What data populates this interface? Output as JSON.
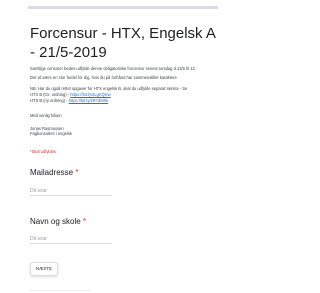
{
  "form": {
    "title": "Forcensur - HTX, Engelsk A - 21/5-2019",
    "description": [
      "Samtlige censorer bedes udfylde denne obligatoriske forcensur senest torsdag d.13/6 kl 12.",
      "Det vil være en stor fordel for dig, hvis du på forhånd har sammenstillet karaktere",
      "NB. Har du også rettet opgaver for HTX engelsk B, skal du udfylde separat skema - Se"
    ],
    "links": [
      {
        "prefix": "HTX B (01- ordning) - ",
        "url": "https://bit.ly/2LgKQKw"
      },
      {
        "prefix": "HTX B (ny ordning) - ",
        "url": "https://bit.ly/2R7dMhk"
      }
    ],
    "closing": "Med venlig hilsen",
    "signature_name": "Jonas Rasmussen",
    "signature_role": "Fagkonsulent i engelsk",
    "required_note": "*Skal udfyldes"
  },
  "fields": [
    {
      "label": "Mailadresse",
      "required_mark": "*",
      "placeholder": "Dit svar"
    },
    {
      "label": "Navn og skole",
      "required_mark": "*",
      "placeholder": "Dit svar"
    }
  ],
  "buttons": {
    "next_label": "NÆSTE"
  },
  "colors": {
    "required": "#d93025",
    "link": "#1a73e8",
    "text": "#202124"
  }
}
